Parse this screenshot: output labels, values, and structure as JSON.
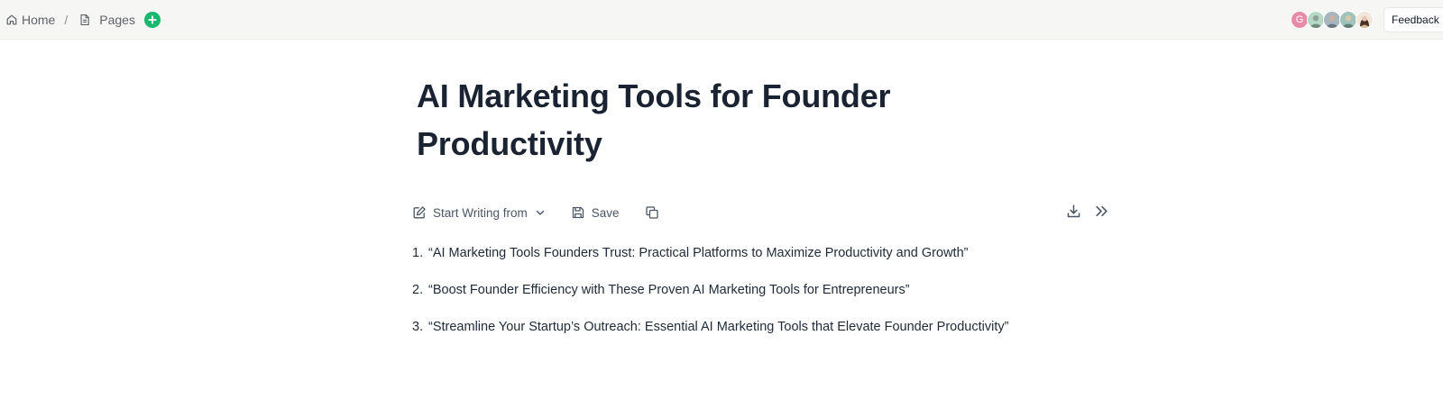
{
  "breadcrumb": {
    "home_label": "Home",
    "separator": "/",
    "pages_label": "Pages"
  },
  "header": {
    "avatars": [
      {
        "initial": "G",
        "color": "#e88ba8"
      },
      {
        "initial": "",
        "color": "#b8d8c8"
      },
      {
        "initial": "",
        "color": "#a7b5bf"
      },
      {
        "initial": "",
        "color": "#9fc3b9"
      },
      {
        "initial": "",
        "color": "#d9b99b"
      }
    ],
    "feedback_label": "Feedback"
  },
  "document": {
    "title": "AI Marketing Tools for Founder Productivity",
    "toolbar": {
      "start_writing_label": "Start Writing from",
      "save_label": "Save"
    },
    "items": [
      {
        "number": "1.",
        "text": "“AI Marketing Tools Founders Trust: Practical Platforms to Maximize Productivity and Growth”"
      },
      {
        "number": "2.",
        "text": "“Boost Founder Efficiency with These Proven AI Marketing Tools for Entrepreneurs”"
      },
      {
        "number": "3.",
        "text": "“Streamline Your Startup’s Outreach: Essential AI Marketing Tools that Elevate Founder Productivity”"
      }
    ]
  },
  "icons": {
    "home": "home-icon",
    "page": "page-icon",
    "add": "plus-icon",
    "edit": "edit-icon",
    "chevron": "chevron-down-icon",
    "save": "save-icon",
    "copy": "copy-icon",
    "download": "download-icon",
    "expand": "chevrons-right-icon"
  },
  "colors": {
    "accent_green": "#1bb76e",
    "title": "#1b2333",
    "topbar_bg": "#f6f6f5"
  }
}
